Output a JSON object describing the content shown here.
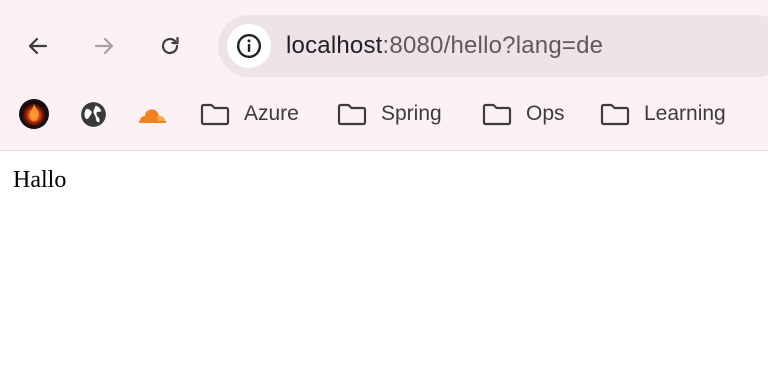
{
  "toolbar": {
    "back_icon": "arrow-left-icon",
    "forward_icon": "arrow-right-icon",
    "reload_icon": "reload-icon",
    "site_info_icon": "info-icon"
  },
  "address_bar": {
    "url_host": "localhost",
    "url_rest": ":8080/hello?lang=de"
  },
  "bookmarks": {
    "items": [
      {
        "label": "",
        "icon": "fire-logo-icon"
      },
      {
        "label": "",
        "icon": "globe-icon"
      },
      {
        "label": "",
        "icon": "cloudflare-icon",
        "color": "#f48120"
      },
      {
        "label": "Azure",
        "icon": "folder-icon"
      },
      {
        "label": "Spring",
        "icon": "folder-icon"
      },
      {
        "label": "Ops",
        "icon": "folder-icon"
      },
      {
        "label": "Learning",
        "icon": "folder-icon"
      }
    ]
  },
  "page": {
    "text": "Hallo"
  },
  "colors": {
    "chrome_background": "#fbf1f6",
    "omnibox_background": "#efe3ea",
    "accent_orange": "#f48120"
  }
}
